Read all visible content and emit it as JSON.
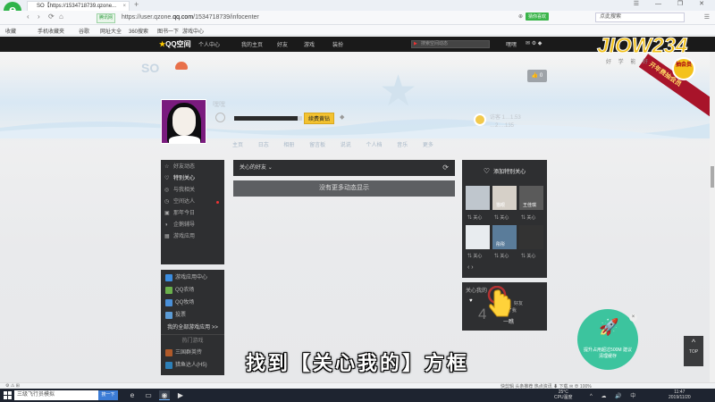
{
  "browser": {
    "tab_title": "SO【https://1534718739.qzone...",
    "tab_close": "×",
    "new_tab": "+",
    "window_controls": "☰ — ❐ ✕",
    "nav_back": "‹",
    "nav_forward": "›",
    "nav_refresh": "⟳",
    "nav_home": "⌂",
    "secure_badge": "腾讯网",
    "url_prefix": "https://user.qzone.",
    "url_domain": "qq.com",
    "url_suffix": "/1534718739/infocenter",
    "extension_badge": "猜你喜欢",
    "search_placeholder": "点此搜索",
    "bookmarks": [
      "收藏",
      "手机收藏夹",
      "谷歌",
      "网址大全",
      "360搜索",
      "游戏中心",
      "谷歌",
      "图书一下",
      "游戏中心"
    ]
  },
  "qzone": {
    "logo_text": "QQ空间",
    "nav": [
      "个人中心",
      "我的主页",
      "好友",
      "游戏",
      "装扮"
    ],
    "search_placeholder": "搜索空间动态",
    "user_label": "嘿嘿",
    "user_icons": "✉ ⚙ ◆",
    "space_title": "SO",
    "nickname": "嘿嘿",
    "vip_button": "续费黄钻",
    "vip_progress": 0.94,
    "visitor_line1": "访客 1…1.53",
    "visitor_line2": "…2….135",
    "like_label": "👍 0",
    "subnav": [
      "主页",
      "日志",
      "相册",
      "留言板",
      "说说",
      "个人档",
      "音乐",
      "更多"
    ]
  },
  "sidebar": {
    "items": [
      {
        "icon": "☆",
        "label": "好友动态",
        "active": false
      },
      {
        "icon": "♡",
        "label": "特别关心",
        "active": true
      },
      {
        "icon": "◎",
        "label": "与我相关",
        "active": false
      },
      {
        "icon": "◷",
        "label": "空间达人",
        "active": false,
        "dot": true
      },
      {
        "icon": "▣",
        "label": "那年今日",
        "active": false
      },
      {
        "icon": "◑",
        "label": "企鹅辅导",
        "active": false
      },
      {
        "icon": "▦",
        "label": "游戏应用",
        "active": false
      }
    ]
  },
  "apps": {
    "items": [
      {
        "label": "游戏应用中心",
        "color": "#3b8de0"
      },
      {
        "label": "QQ农场",
        "color": "#6ab04c"
      },
      {
        "label": "QQ牧场",
        "color": "#4a90d9"
      },
      {
        "label": "投票",
        "color": "#5b9bd5"
      }
    ],
    "more_label": "我的全部游戏应用 >>",
    "section_label": "热门游戏",
    "games": [
      {
        "label": "三国群英传",
        "color": "#b05a2a"
      },
      {
        "label": "猎鱼达人(H5)",
        "color": "#2c7fb8"
      }
    ]
  },
  "feed": {
    "header_label": "关心的好友",
    "dropdown_icon": "⌄",
    "refresh_icon": "⟳",
    "empty_text": "没有更多动态显示"
  },
  "care_panel": {
    "title": "添加特别关心",
    "friends": [
      {
        "name": "",
        "color": "#bfc6cd"
      },
      {
        "name": "猫眼",
        "color": "#d6d0c8"
      },
      {
        "name": "王佳琪",
        "color": "#5a5a5a"
      },
      {
        "name": "",
        "color": "#e8ecef"
      },
      {
        "name": "彤彤",
        "color": "#5a7c9a"
      },
      {
        "name": "",
        "color": "#333"
      }
    ],
    "care_label": "关心",
    "arrows": "‹ ›"
  },
  "care_stats": {
    "title": "关心我的",
    "count": "4",
    "line1": "好友",
    "line2": "9了我",
    "line3": "一瞧"
  },
  "promo": {
    "banner": "开年费抽会员",
    "badge": "抽会员",
    "watermark": "JIOW234",
    "watermark_sub": "好 学 能 好"
  },
  "rocket": {
    "text": "提升占用超过500M\n建议清理缓存",
    "close": "×"
  },
  "totop": {
    "icon": "^",
    "label": "TOP"
  },
  "caption": "找到【关心我的】方框",
  "status": {
    "left": "⚙  ⚠  ⊞",
    "right": "快剪辑    头条推荐    热点资讯    ⬇ 下载    ✉    ⊕  100%"
  },
  "taskbar": {
    "search_placeholder": "三级飞行员模拟",
    "search_button": "搜一下",
    "weather_temp": "25°C",
    "weather_label": "CPU温度",
    "tray": "^ ☁ 🔊 中",
    "time": "11:47",
    "date": "2019/11/20"
  }
}
